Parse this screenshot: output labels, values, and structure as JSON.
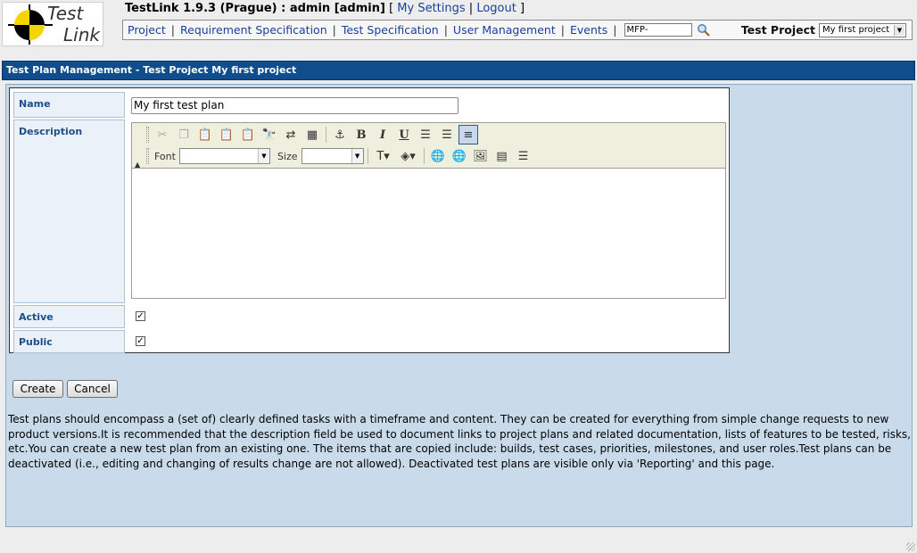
{
  "header": {
    "logo_text_top": "Test",
    "logo_text_bottom": "Link",
    "app_title": "TestLink 1.9.3 (Prague) : admin [admin]",
    "bracket_open": "[",
    "bracket_close": "]",
    "bar_sep": "|",
    "my_settings": "My Settings",
    "logout": "Logout"
  },
  "menu": {
    "items": [
      "Project",
      "Requirement Specification",
      "Test Specification",
      "User Management",
      "Events"
    ],
    "testcase_search_value": "MFP-",
    "test_project_label": "Test Project",
    "test_project_selected": "My first project"
  },
  "page": {
    "title": "Test Plan Management - Test Project My first project"
  },
  "form": {
    "name_label": "Name",
    "name_value": "My first test plan",
    "description_label": "Description",
    "active_label": "Active",
    "active_checked": true,
    "public_label": "Public",
    "public_checked": true,
    "font_label": "Font",
    "size_label": "Size",
    "create_button": "Create",
    "cancel_button": "Cancel"
  },
  "help_text": "Test plans should encompass a (set of) clearly defined tasks with a timeframe and content. They can be created for everything from simple change requests to new product versions.It is recommended that the description field be used to document links to project plans and related documentation, lists of features to be tested, risks, etc.You can create a new test plan from an existing one. The items that are copied include: builds, test cases, priorities, milestones, and user roles.Test plans can be deactivated (i.e., editing and changing of results change are not allowed). Deactivated test plans are visible only via 'Reporting' and this page.",
  "colors": {
    "title_bar": "#0f4d8c",
    "panel_bg": "#c9dbea",
    "label_text": "#1e4e8a",
    "link": "#1a3f9a"
  }
}
